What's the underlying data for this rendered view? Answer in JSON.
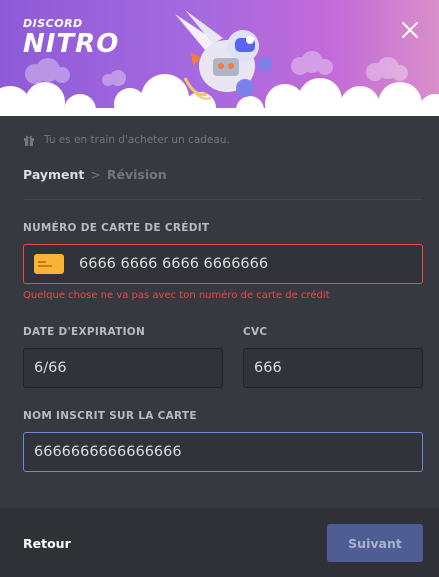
{
  "header": {
    "logo_line1": "DISCORD",
    "logo_line2": "NITRO",
    "close_icon": "close-icon"
  },
  "gift": {
    "icon": "gift-icon",
    "text": "Tu es en train d'acheter un cadeau."
  },
  "steps": {
    "current": "Payment",
    "separator": ">",
    "next": "Révision"
  },
  "card_number": {
    "label": "NUMÉRO DE CARTE DE CRÉDIT",
    "value": "6666 6666 6666 6666666",
    "icon": "credit-card-icon",
    "error": "Quelque chose ne va pas avec ton numéro de carte de crédit"
  },
  "expiration": {
    "label": "DATE D'EXPIRATION",
    "value": "6/66"
  },
  "cvc": {
    "label": "CVC",
    "value": "666"
  },
  "name_on_card": {
    "label": "NOM INSCRIT SUR LA CARTE",
    "value": "6666666666666666"
  },
  "footer": {
    "back_label": "Retour",
    "next_label": "Suivant"
  },
  "colors": {
    "background": "#36393f",
    "footer": "#2f3136",
    "error": "#f04747",
    "accent": "#7289da",
    "header_gradient_start": "#8e5bd6",
    "header_gradient_end": "#d98fc9"
  }
}
